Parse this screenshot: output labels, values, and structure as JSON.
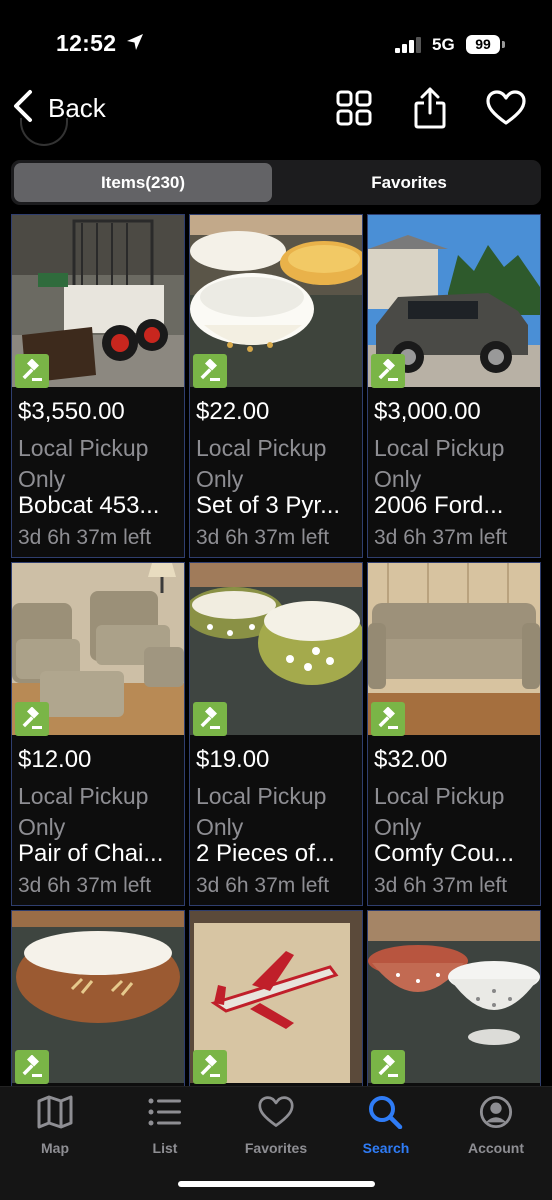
{
  "status_bar": {
    "time": "12:52",
    "network": "5G",
    "battery": "99"
  },
  "nav": {
    "back_label": "Back",
    "icons": [
      "grid-view-icon",
      "share-icon",
      "heart-icon"
    ]
  },
  "segments": {
    "items_label": "Items(230)",
    "favorites_label": "Favorites",
    "active": "items"
  },
  "items": [
    {
      "price": "$3,550.00",
      "pickup": "Local Pickup Only",
      "title": "Bobcat 453...",
      "time_left": "3d 6h 37m left",
      "image": "skid-steer-loader"
    },
    {
      "price": "$22.00",
      "pickup": "Local Pickup Only",
      "title": "Set of 3 Pyr...",
      "time_left": "3d 6h 37m left",
      "image": "mixing-bowls"
    },
    {
      "price": "$3,000.00",
      "pickup": "Local Pickup Only",
      "title": "2006 Ford...",
      "time_left": "3d 6h 37m left",
      "image": "suv"
    },
    {
      "price": "$12.00",
      "pickup": "Local Pickup Only",
      "title": "Pair of Chai...",
      "time_left": "3d 6h 37m left",
      "image": "armchairs"
    },
    {
      "price": "$19.00",
      "pickup": "Local Pickup Only",
      "title": "2 Pieces of...",
      "time_left": "3d 6h 37m left",
      "image": "casserole-dishes"
    },
    {
      "price": "$32.00",
      "pickup": "Local Pickup Only",
      "title": "Comfy Cou...",
      "time_left": "3d 6h 37m left",
      "image": "couch"
    },
    {
      "image": "oval-dish"
    },
    {
      "image": "airplane-needlework"
    },
    {
      "image": "colanders"
    }
  ],
  "tabs": [
    {
      "label": "Map",
      "icon": "map-icon"
    },
    {
      "label": "List",
      "icon": "list-icon"
    },
    {
      "label": "Favorites",
      "icon": "heart-icon"
    },
    {
      "label": "Search",
      "icon": "search-icon",
      "active": true
    },
    {
      "label": "Account",
      "icon": "account-icon"
    }
  ],
  "colors": {
    "accent": "#2f7cf6",
    "gavel_badge": "#7ab547",
    "card_border": "#2f3e6e",
    "muted_text": "#8e8e93"
  }
}
